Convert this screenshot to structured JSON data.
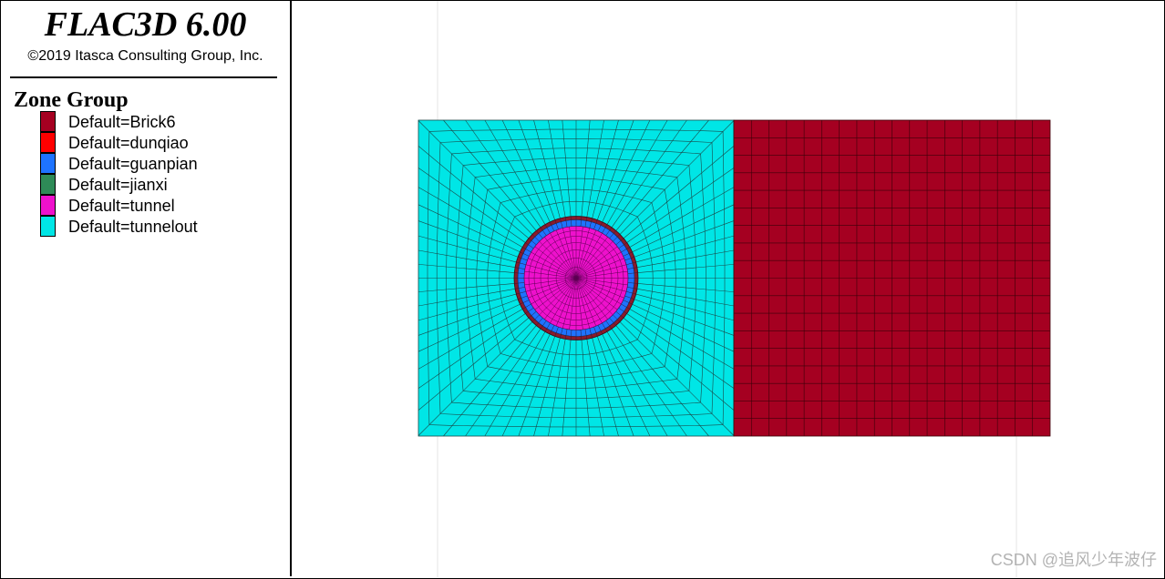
{
  "app": {
    "title": "FLAC3D 6.00",
    "copyright": "©2019 Itasca Consulting Group, Inc."
  },
  "legend": {
    "title": "Zone Group",
    "items": [
      {
        "label": "Default=Brick6",
        "color": "#a50021"
      },
      {
        "label": "Default=dunqiao",
        "color": "#ff0000"
      },
      {
        "label": "Default=guanpian",
        "color": "#1e73ff"
      },
      {
        "label": "Default=jianxi",
        "color": "#2e8b57"
      },
      {
        "label": "Default=tunnel",
        "color": "#ee11cc"
      },
      {
        "label": "Default=tunnelout",
        "color": "#00e6e6"
      }
    ]
  },
  "watermark": "CSDN @追风少年波仔"
}
